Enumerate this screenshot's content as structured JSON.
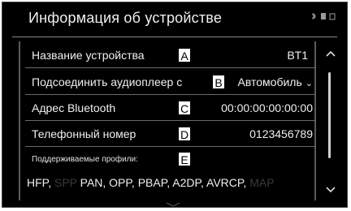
{
  "screen": {
    "title": "Информация об устройстве",
    "status_icons": [
      "bluetooth-muted-icon",
      "phone-icon",
      "battery-icon"
    ]
  },
  "rows": [
    {
      "label": "Название устройства",
      "tag": "A",
      "value": "BT1"
    },
    {
      "label": "Подсоединить аудиоплеер с",
      "tag": "B",
      "value": "Автомобиль",
      "has_dropdown": true
    },
    {
      "label": "Адрес Bluetooth",
      "tag": "C",
      "value": "00:00:00:00:00:00"
    },
    {
      "label": "Телефонный номер",
      "tag": "D",
      "value": "0123456789"
    }
  ],
  "profiles": {
    "header": "Поддерживаемые профили:",
    "tag": "E",
    "items": [
      "HFP,",
      "SPP",
      "PAN, OPP, PBAP, A2DP, AVRCP,",
      "MAP"
    ]
  },
  "colors": {
    "background": "#000000",
    "text": "#f0f0f0",
    "dimmed": "#3a3a3a"
  }
}
